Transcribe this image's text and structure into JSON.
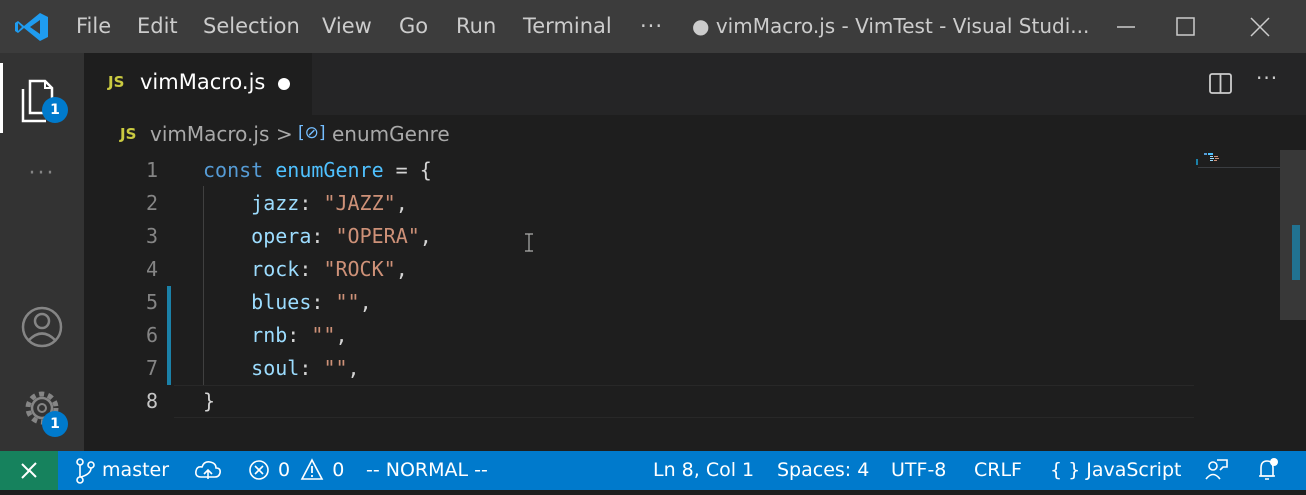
{
  "titlebar": {
    "menu": [
      "File",
      "Edit",
      "Selection",
      "View",
      "Go",
      "Run",
      "Terminal"
    ],
    "more": "···",
    "dirty_dot": "●",
    "window_title": "vimMacro.js - VimTest - Visual Studi..."
  },
  "activity": {
    "explorer_badge": "1",
    "more": "···",
    "manage_badge": "1"
  },
  "tab": {
    "icon_text": "JS",
    "filename": "vimMacro.js"
  },
  "breadcrumb": {
    "icon_text": "JS",
    "file": "vimMacro.js",
    "separator": ">",
    "symbol": "enumGenre"
  },
  "editor": {
    "line_numbers": [
      "1",
      "2",
      "3",
      "4",
      "5",
      "6",
      "7",
      "8"
    ],
    "current_line": 8,
    "lines": [
      [
        {
          "t": "kw",
          "v": "const "
        },
        {
          "t": "var",
          "v": "enumGenre"
        },
        {
          "t": "pun",
          "v": " = {"
        }
      ],
      [
        {
          "t": "pun",
          "v": "    "
        },
        {
          "t": "prop",
          "v": "jazz"
        },
        {
          "t": "pun",
          "v": ": "
        },
        {
          "t": "str",
          "v": "\"JAZZ\""
        },
        {
          "t": "pun",
          "v": ","
        }
      ],
      [
        {
          "t": "pun",
          "v": "    "
        },
        {
          "t": "prop",
          "v": "opera"
        },
        {
          "t": "pun",
          "v": ": "
        },
        {
          "t": "str",
          "v": "\"OPERA\""
        },
        {
          "t": "pun",
          "v": ","
        }
      ],
      [
        {
          "t": "pun",
          "v": "    "
        },
        {
          "t": "prop",
          "v": "rock"
        },
        {
          "t": "pun",
          "v": ": "
        },
        {
          "t": "str",
          "v": "\"ROCK\""
        },
        {
          "t": "pun",
          "v": ","
        }
      ],
      [
        {
          "t": "pun",
          "v": "    "
        },
        {
          "t": "prop",
          "v": "blues"
        },
        {
          "t": "pun",
          "v": ": "
        },
        {
          "t": "str",
          "v": "\"\""
        },
        {
          "t": "pun",
          "v": ","
        }
      ],
      [
        {
          "t": "pun",
          "v": "    "
        },
        {
          "t": "prop",
          "v": "rnb"
        },
        {
          "t": "pun",
          "v": ": "
        },
        {
          "t": "str",
          "v": "\"\""
        },
        {
          "t": "pun",
          "v": ","
        }
      ],
      [
        {
          "t": "pun",
          "v": "    "
        },
        {
          "t": "prop",
          "v": "soul"
        },
        {
          "t": "pun",
          "v": ": "
        },
        {
          "t": "str",
          "v": "\"\""
        },
        {
          "t": "pun",
          "v": ","
        }
      ],
      [
        {
          "t": "pun",
          "v": "}"
        }
      ]
    ]
  },
  "statusbar": {
    "branch": "master",
    "errors": "0",
    "warnings": "0",
    "vim_mode": "-- NORMAL --",
    "position": "Ln 8, Col 1",
    "spaces": "Spaces: 4",
    "encoding": "UTF-8",
    "eol": "CRLF",
    "language": "JavaScript"
  },
  "colors": {
    "titlebar": "#3c3c3c",
    "activitybar": "#333333",
    "editor_bg": "#1e1e1e",
    "statusbar": "#007acc",
    "remote": "#16825d",
    "modified_gutter": "#1b81a8"
  }
}
